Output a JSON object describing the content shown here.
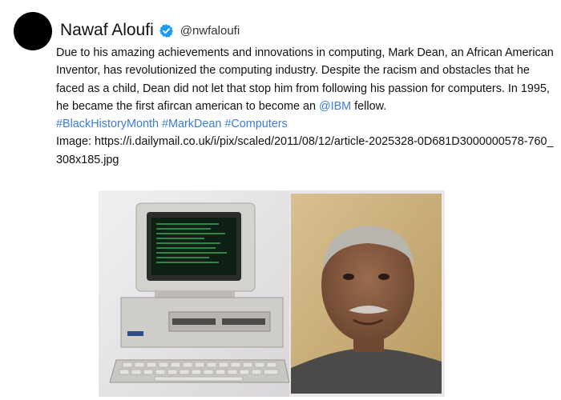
{
  "tweet": {
    "display_name": "Nawaf Aloufi",
    "verified_icon": "verified-badge-icon",
    "handle": "@nwfaloufi",
    "text_main": "Due to his amazing achievements and innovations in computing, Mark Dean, an African American Inventor, has revolutionized the computing industry. Despite the racism and obstacles that he faced as a child, Dean did not let that stop him from following his passion for computers. In 1995, he became the first afircan american to become an",
    "mention": "@IBM",
    "text_after_mention": "fellow.",
    "hashtags": [
      "#BlackHistoryMonth",
      "#MarkDean",
      "#Computers"
    ],
    "image_label": "Image: ",
    "image_url": "https://i.dailymail.co.uk/i/pix/scaled/2011/08/12/article-2025328-0D681D3000000578-760_308x185.jpg"
  },
  "colors": {
    "link": "#3b7bd9",
    "verified": "#1d9bf0",
    "avatar": "#000000"
  }
}
